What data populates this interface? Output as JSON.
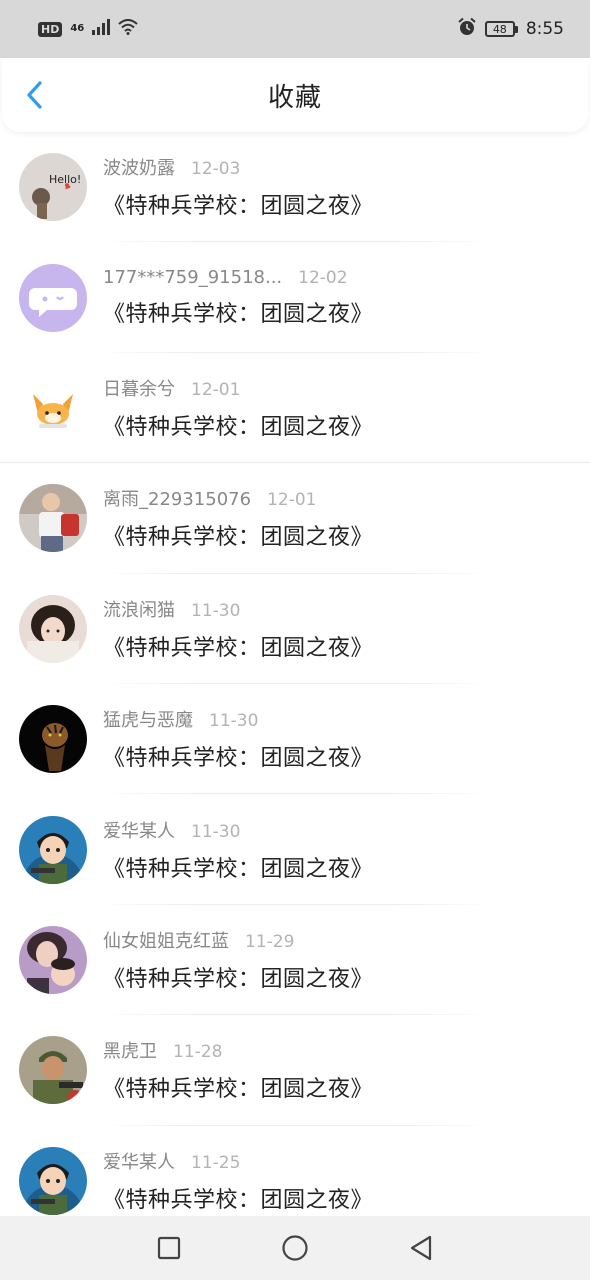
{
  "status_bar": {
    "hd": "HD",
    "network": "46",
    "battery": "48",
    "time": "8:55",
    "icons": [
      "hd-icon",
      "signal-icon",
      "wifi-icon",
      "alarm-icon",
      "battery-icon"
    ]
  },
  "header": {
    "title": "收藏",
    "back_icon": "chevron-left-icon",
    "accent_color": "#2f9ee8"
  },
  "items": [
    {
      "user": "波波奶露",
      "date": "12-03",
      "title": "《特种兵学校：团圆之夜》"
    },
    {
      "user": "177***759_91518...",
      "date": "12-02",
      "title": "《特种兵学校：团圆之夜》"
    },
    {
      "user": "日暮余兮",
      "date": "12-01",
      "title": "《特种兵学校：团圆之夜》"
    },
    {
      "user": "离雨_229315076",
      "date": "12-01",
      "title": "《特种兵学校：团圆之夜》"
    },
    {
      "user": "流浪闲猫",
      "date": "11-30",
      "title": "《特种兵学校：团圆之夜》"
    },
    {
      "user": "猛虎与恶魔",
      "date": "11-30",
      "title": "《特种兵学校：团圆之夜》"
    },
    {
      "user": "爱华某人",
      "date": "11-30",
      "title": "《特种兵学校：团圆之夜》"
    },
    {
      "user": "仙女姐姐克红蓝",
      "date": "11-29",
      "title": "《特种兵学校：团圆之夜》"
    },
    {
      "user": "黑虎卫",
      "date": "11-28",
      "title": "《特种兵学校：团圆之夜》"
    },
    {
      "user": "爱华某人",
      "date": "11-25",
      "title": "《特种兵学校：团圆之夜》"
    }
  ],
  "avatar_text": {
    "hello": "Hello!"
  },
  "nav": {
    "icons": [
      "recents-square-icon",
      "home-circle-icon",
      "back-triangle-icon"
    ]
  }
}
